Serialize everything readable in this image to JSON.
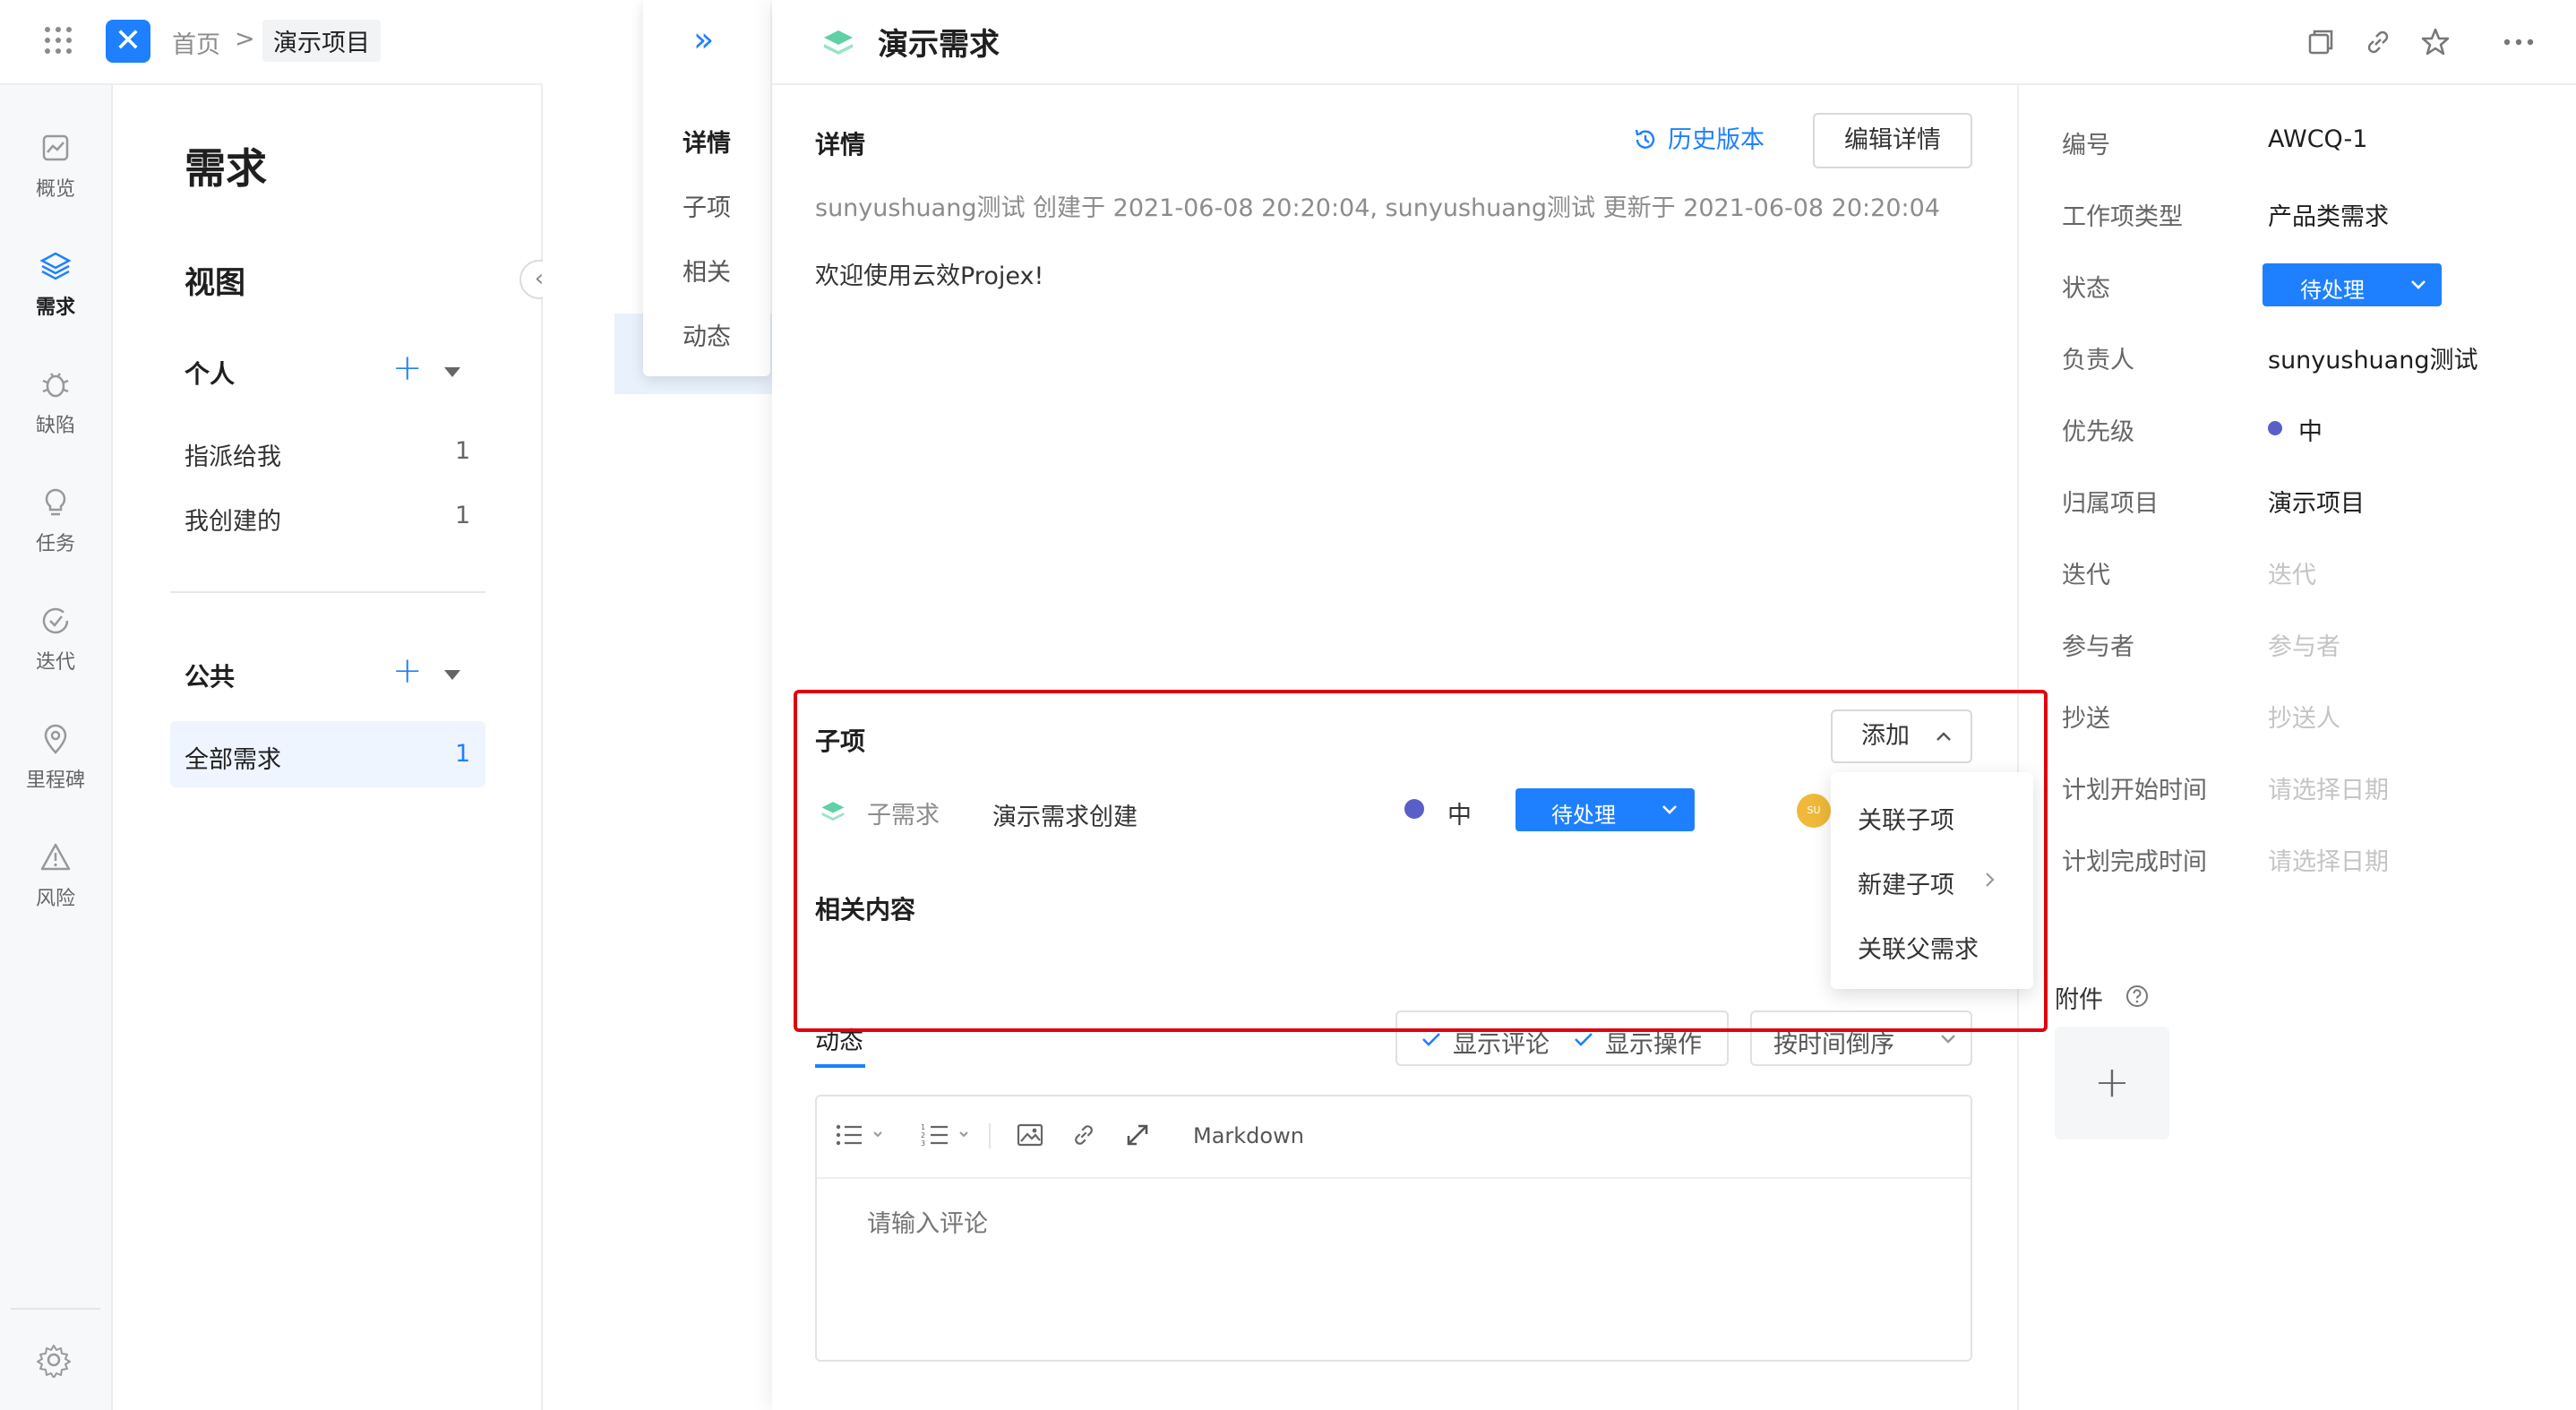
{
  "breadcrumb": {
    "home": "首页",
    "separator": ">",
    "current": "演示项目"
  },
  "nav": {
    "items": [
      {
        "label": "概览",
        "icon": "chart-icon"
      },
      {
        "label": "需求",
        "icon": "layers-icon"
      },
      {
        "label": "缺陷",
        "icon": "bug-icon"
      },
      {
        "label": "任务",
        "icon": "lightbulb-icon"
      },
      {
        "label": "迭代",
        "icon": "cycle-icon"
      },
      {
        "label": "里程碑",
        "icon": "milestone-icon"
      },
      {
        "label": "风险",
        "icon": "warning-icon"
      }
    ],
    "active": "需求"
  },
  "views": {
    "title": "需求",
    "subtitle": "视图",
    "personal_label": "个人",
    "personal_items": [
      {
        "label": "指派给我",
        "count": "1"
      },
      {
        "label": "我创建的",
        "count": "1"
      }
    ],
    "public_label": "公共",
    "public_items": [
      {
        "label": "全部需求",
        "count": "1"
      }
    ]
  },
  "subnav": {
    "expand_glyph": "»",
    "items": [
      "详情",
      "子项",
      "相关",
      "动态"
    ],
    "active": "详情"
  },
  "detail": {
    "title": "演示需求",
    "section_detail": "详情",
    "history_label": "历史版本",
    "edit_label": "编辑详情",
    "meta": "sunyushuang测试 创建于 2021-06-08 20:20:04, sunyushuang测试 更新于 2021-06-08 20:20:04",
    "description": "欢迎使用云效Projex!",
    "subitems": {
      "heading": "子项",
      "add_label": "添加",
      "rows": [
        {
          "type": "子需求",
          "title": "演示需求创建",
          "priority": "中",
          "status": "待处理",
          "avatar": "SU"
        }
      ]
    },
    "add_menu": [
      "关联子项",
      "新建子项",
      "关联父需求"
    ],
    "related_heading": "相关内容",
    "activity": {
      "tab": "动态",
      "show_comments": "显示评论",
      "show_ops": "显示操作",
      "sort": "按时间倒序"
    },
    "editor": {
      "markdown_label": "Markdown",
      "placeholder": "请输入评论"
    }
  },
  "props": {
    "id_label": "编号",
    "id_value": "AWCQ-1",
    "type_label": "工作项类型",
    "type_value": "产品类需求",
    "status_label": "状态",
    "status_value": "待处理",
    "owner_label": "负责人",
    "owner_value": "sunyushuang测试",
    "priority_label": "优先级",
    "priority_value": "中",
    "project_label": "归属项目",
    "project_value": "演示项目",
    "sprint_label": "迭代",
    "sprint_placeholder": "迭代",
    "participants_label": "参与者",
    "participants_placeholder": "参与者",
    "cc_label": "抄送",
    "cc_placeholder": "抄送人",
    "start_label": "计划开始时间",
    "start_placeholder": "请选择日期",
    "end_label": "计划完成时间",
    "end_placeholder": "请选择日期",
    "attachments_label": "附件",
    "attach_add": "+"
  },
  "colors": {
    "accent": "#1e80ff",
    "priority_dot": "#5a5ec8",
    "highlight": "#e0000f"
  }
}
